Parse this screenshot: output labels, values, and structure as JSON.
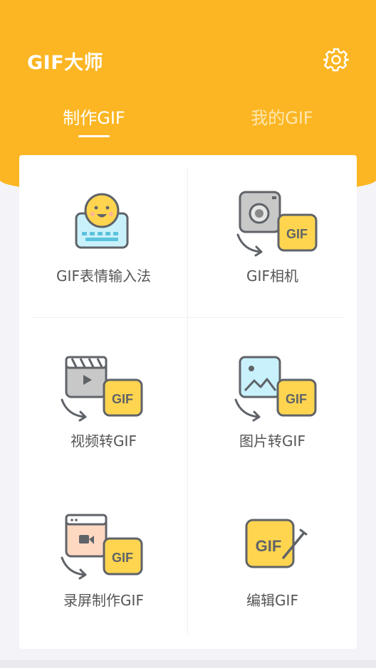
{
  "header": {
    "title": "GIF大师",
    "settings_icon": "gear-icon",
    "bg_color": "#fcb623"
  },
  "tabs": [
    {
      "label": "制作GIF",
      "active": true
    },
    {
      "label": "我的GIF",
      "active": false
    }
  ],
  "tools": [
    {
      "label": "GIF表情输入法",
      "icon": "emoji-keyboard-icon"
    },
    {
      "label": "GIF相机",
      "icon": "camera-to-gif-icon"
    },
    {
      "label": "视频转GIF",
      "icon": "video-to-gif-icon"
    },
    {
      "label": "图片转GIF",
      "icon": "image-to-gif-icon"
    },
    {
      "label": "录屏制作GIF",
      "icon": "screen-record-to-gif-icon"
    },
    {
      "label": "编辑GIF",
      "icon": "edit-gif-icon"
    }
  ],
  "gif_badge": "GIF",
  "colors": {
    "accent": "#fcb623",
    "badge": "#ffd54f",
    "outline": "#5f6368",
    "label": "#555555"
  }
}
